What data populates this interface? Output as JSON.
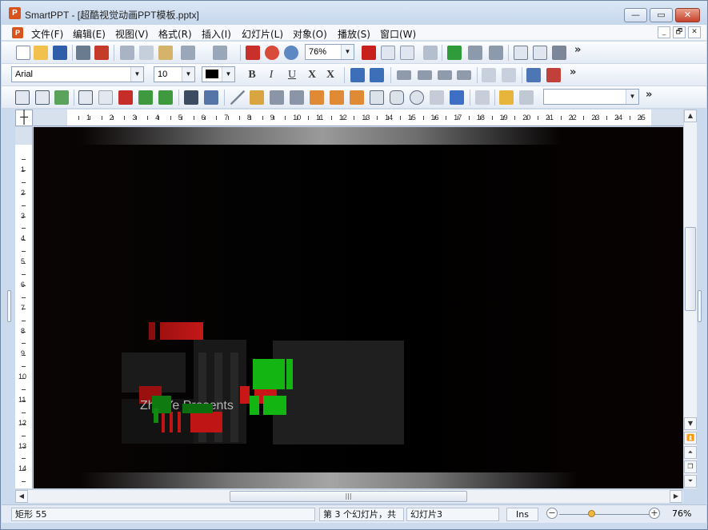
{
  "window": {
    "app_icon": "P",
    "title": "SmartPPT - [超酷视觉动画PPT模板.pptx]",
    "controls": {
      "minimize": "—",
      "maximize": "▭",
      "close": "✕"
    }
  },
  "menubar": {
    "icon": "P",
    "items": [
      {
        "label": "文件(F)"
      },
      {
        "label": "编辑(E)"
      },
      {
        "label": "视图(V)"
      },
      {
        "label": "格式(R)"
      },
      {
        "label": "插入(I)"
      },
      {
        "label": "幻灯片(L)"
      },
      {
        "label": "对象(O)"
      },
      {
        "label": "播放(S)"
      },
      {
        "label": "窗口(W)"
      }
    ],
    "mdi_controls": {
      "minimize": "_",
      "restore": "🗗",
      "close": "✕"
    }
  },
  "toolbar1": {
    "zoom_value": "76%",
    "more": "»"
  },
  "toolbar2": {
    "font_name": "Arial",
    "font_size": "10",
    "bold": "B",
    "italic": "I",
    "underline": "U",
    "strike": "X",
    "more": "»"
  },
  "toolbar3": {
    "object_combo": "",
    "more": "»"
  },
  "ruler": {
    "corner": "┼",
    "h_labels": [
      "1",
      "2",
      "3",
      "4",
      "5",
      "6",
      "7",
      "8",
      "9",
      "10",
      "11",
      "12",
      "13",
      "14",
      "15",
      "16",
      "17",
      "18",
      "19",
      "20",
      "21",
      "22",
      "23",
      "24",
      "25"
    ],
    "v_labels": [
      "1",
      "2",
      "3",
      "4",
      "5",
      "6",
      "7",
      "8",
      "9",
      "10",
      "11",
      "12",
      "13",
      "14"
    ]
  },
  "slide": {
    "text": "ZhaiYe Presents"
  },
  "statusbar": {
    "selection": "矩形 55",
    "slide_position": "第 3 个幻灯片，共",
    "slide_name": "幻灯片3",
    "mode": "Ins",
    "zoom": "76%"
  },
  "colors": {
    "accent_red": "#c81414",
    "accent_green": "#13b513",
    "window_frame": "#cbdaed"
  }
}
